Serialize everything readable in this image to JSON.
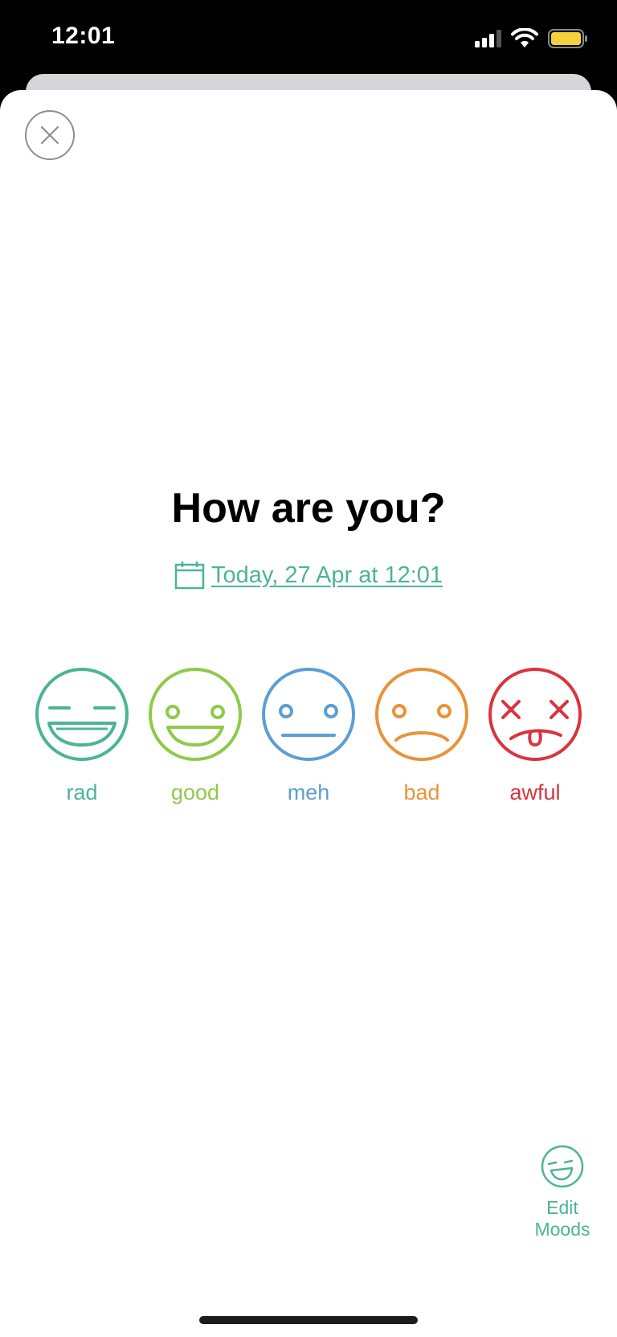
{
  "status_bar": {
    "time": "12:01",
    "icons": [
      "signal-icon",
      "wifi-icon",
      "battery-icon"
    ],
    "battery_color": "#f4d03f"
  },
  "sheet": {
    "close_icon": "close-icon",
    "title": "How are you?",
    "date_label": "Today, 27 Apr at 12:01",
    "date_icon": "calendar-icon",
    "accent_color": "#4bb594"
  },
  "moods": [
    {
      "label": "rad",
      "color": "#4bb594",
      "icon": "rad-face-icon"
    },
    {
      "label": "good",
      "color": "#8fc94a",
      "icon": "good-face-icon"
    },
    {
      "label": "meh",
      "color": "#5b9fd3",
      "icon": "meh-face-icon"
    },
    {
      "label": "bad",
      "color": "#e8933a",
      "icon": "bad-face-icon"
    },
    {
      "label": "awful",
      "color": "#d9343f",
      "icon": "awful-face-icon"
    }
  ],
  "edit_moods": {
    "label_line1": "Edit",
    "label_line2": "Moods",
    "icon": "edit-moods-face-icon"
  }
}
